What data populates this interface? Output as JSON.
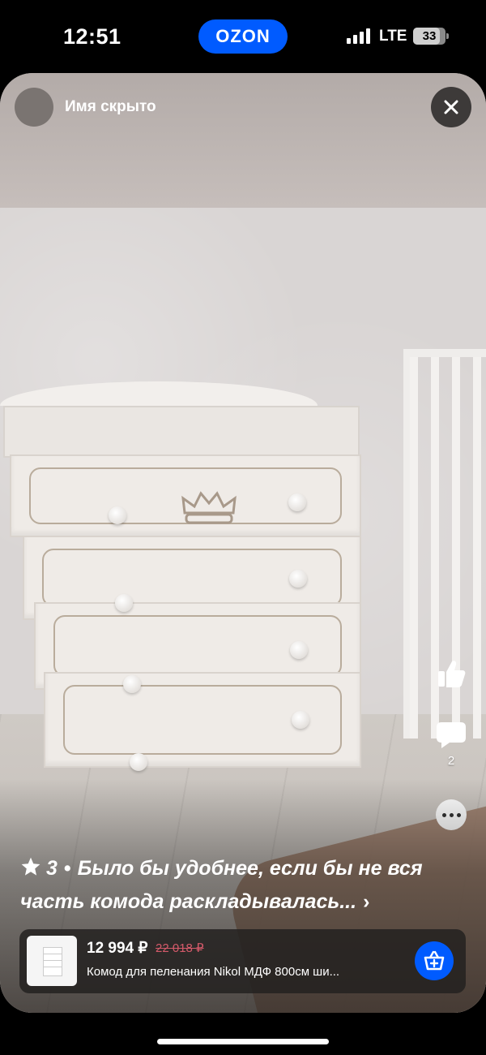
{
  "status_bar": {
    "time": "12:51",
    "app_name": "OZON",
    "network": "LTE",
    "battery": "33"
  },
  "review_card": {
    "author": "Имя скрыто",
    "rating": "3",
    "text": "Было бы удобнее, если бы не вся часть комода раскладывалась...",
    "comments_count": "2"
  },
  "product": {
    "price": "12 994 ₽",
    "old_price": "22 018 ₽",
    "name": "Комод для пеленания Nikol МДФ 800см ши..."
  },
  "colors": {
    "brand": "#005bff",
    "old_price": "#d45a6a"
  },
  "icons": [
    "close-icon",
    "thumbs-up-icon",
    "comment-icon",
    "more-icon",
    "star-icon",
    "chevron-right-icon",
    "add-to-cart-icon"
  ]
}
